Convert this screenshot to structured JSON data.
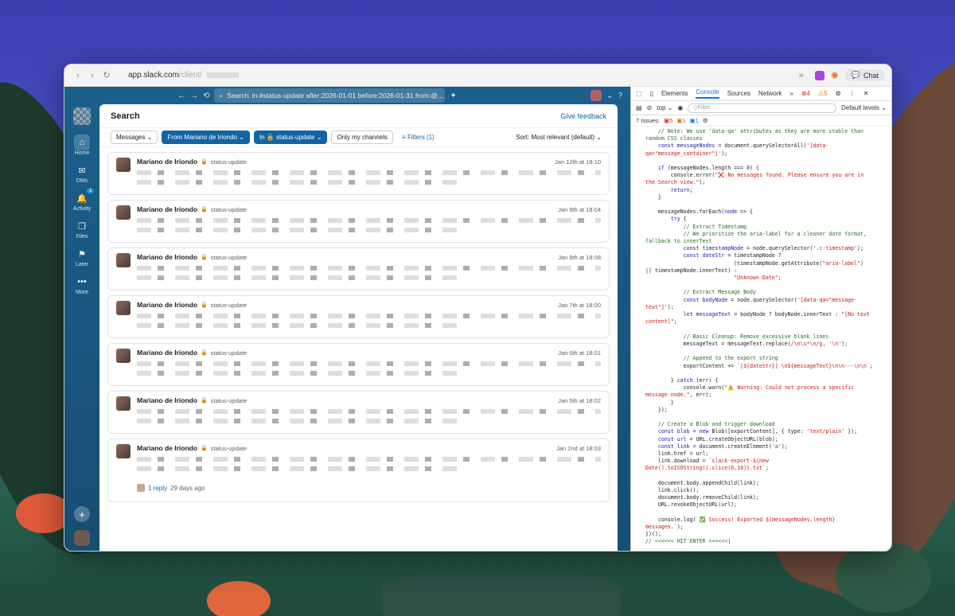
{
  "browser": {
    "url_host": "app.slack.com",
    "url_path": "/client/",
    "chat_label": "Chat"
  },
  "slack_top": {
    "search_text": "Search: in:#status-update after:2026-01-01 before:2026-01-31 from:@..."
  },
  "rail": {
    "items": [
      {
        "label": "Home",
        "icon": "home-icon"
      },
      {
        "label": "DMs",
        "icon": "dm-icon"
      },
      {
        "label": "Activity",
        "icon": "bell-icon",
        "badge": "1"
      },
      {
        "label": "Files",
        "icon": "files-icon"
      },
      {
        "label": "Later",
        "icon": "bookmark-icon"
      },
      {
        "label": "More",
        "icon": "more-icon"
      }
    ]
  },
  "panel": {
    "title": "Search",
    "feedback": "Give feedback",
    "filters": {
      "messages": "Messages",
      "from": "From Mariano de Iriondo",
      "in": "In 🔒 status-update",
      "only_channels": "Only my channels",
      "filters": "Filters (1)",
      "sort": "Sort: Most relevant (default)"
    }
  },
  "results": [
    {
      "author": "Mariano de Iriondo",
      "channel": "status-update",
      "date": "Jan 12th at 18:10"
    },
    {
      "author": "Mariano de Iriondo",
      "channel": "status-update",
      "date": "Jan 9th at 18:04"
    },
    {
      "author": "Mariano de Iriondo",
      "channel": "status-update",
      "date": "Jan 8th at 18:08"
    },
    {
      "author": "Mariano de Iriondo",
      "channel": "status-update",
      "date": "Jan 7th at 18:00"
    },
    {
      "author": "Mariano de Iriondo",
      "channel": "status-update",
      "date": "Jan 6th at 18:01"
    },
    {
      "author": "Mariano de Iriondo",
      "channel": "status-update",
      "date": "Jan 5th at 18:02"
    },
    {
      "author": "Mariano de Iriondo",
      "channel": "status-update",
      "date": "Jan 2nd at 18:03",
      "reply": "1 reply",
      "reply_ago": "29 days ago"
    }
  ],
  "devtools": {
    "tabs": [
      "Elements",
      "Console",
      "Sources",
      "Network"
    ],
    "active_tab": "Console",
    "context": "top",
    "filter_placeholder": "Filter",
    "levels": "Default levels",
    "issues_label": "7 Issues:",
    "issues_err": "5",
    "issues_warn": "1",
    "issues_info": "1",
    "counts_err": "4",
    "counts_warn": "5"
  }
}
